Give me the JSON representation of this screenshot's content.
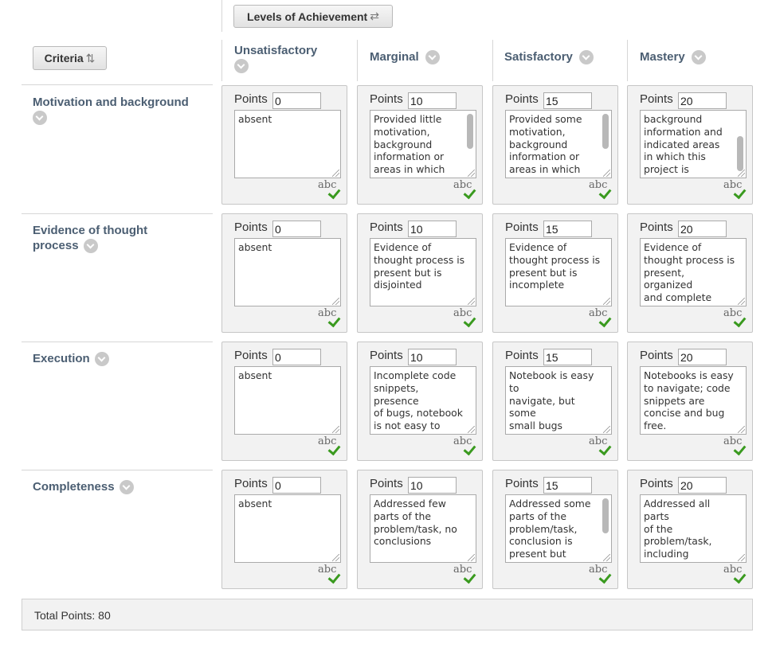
{
  "toolbar": {
    "levels_label": "Levels of Achievement",
    "levels_icon": "swap-arrows-icon",
    "criteria_label": "Criteria",
    "criteria_icon": "sort-arrows-icon"
  },
  "columns": [
    {
      "label": "Unsatisfactory"
    },
    {
      "label": "Marginal"
    },
    {
      "label": "Satisfactory"
    },
    {
      "label": "Mastery"
    }
  ],
  "points_label": "Points",
  "rows": [
    {
      "criterion": "Motivation and background",
      "cells": [
        {
          "points": "0",
          "text": "absent"
        },
        {
          "points": "10",
          "text": "Provided little\nmotivation,\nbackground\ninformation or\nareas in which\nthis project is"
        },
        {
          "points": "15",
          "text": "Provided some\nmotivation,\nbackground\ninformation or\nareas in which\nthis project is"
        },
        {
          "points": "20",
          "text": "background\ninformation and\nindicated areas\nin which this\nproject is\nrelevant"
        }
      ]
    },
    {
      "criterion": "Evidence of thought process",
      "cells": [
        {
          "points": "0",
          "text": "absent"
        },
        {
          "points": "10",
          "text": "Evidence of\nthought process is\npresent but is\ndisjointed"
        },
        {
          "points": "15",
          "text": "Evidence of\nthought process is\npresent but is\nincomplete"
        },
        {
          "points": "20",
          "text": "Evidence of\nthought process is\npresent, organized\nand complete"
        }
      ]
    },
    {
      "criterion": "Execution",
      "cells": [
        {
          "points": "0",
          "text": "absent"
        },
        {
          "points": "10",
          "text": "Incomplete code\nsnippets, presence\nof bugs, notebook\nis not easy to\nnavigate/read."
        },
        {
          "points": "15",
          "text": "Notebook is easy to\nnavigate, but some\nsmall bugs"
        },
        {
          "points": "20",
          "text": "Notebooks is easy\nto navigate; code\nsnippets are\nconcise and bug\nfree."
        }
      ]
    },
    {
      "criterion": "Completeness",
      "cells": [
        {
          "points": "0",
          "text": "absent"
        },
        {
          "points": "10",
          "text": "Addressed few\nparts of the\nproblem/task, no\nconclusions"
        },
        {
          "points": "15",
          "text": "Addressed some\nparts of the\nproblem/task,\nconclusion is\npresent but\ninsufficient"
        },
        {
          "points": "20",
          "text": "Addressed all parts\nof the\nproblem/task,\nincluding\nconclusions.."
        }
      ]
    }
  ],
  "spellcheck_label": "abc",
  "footer": {
    "total_label": "Total Points: 80"
  },
  "colors": {
    "header_text": "#4b5e72",
    "cell_bg": "#f2f2f2",
    "check_green": "#3a9a1f"
  }
}
